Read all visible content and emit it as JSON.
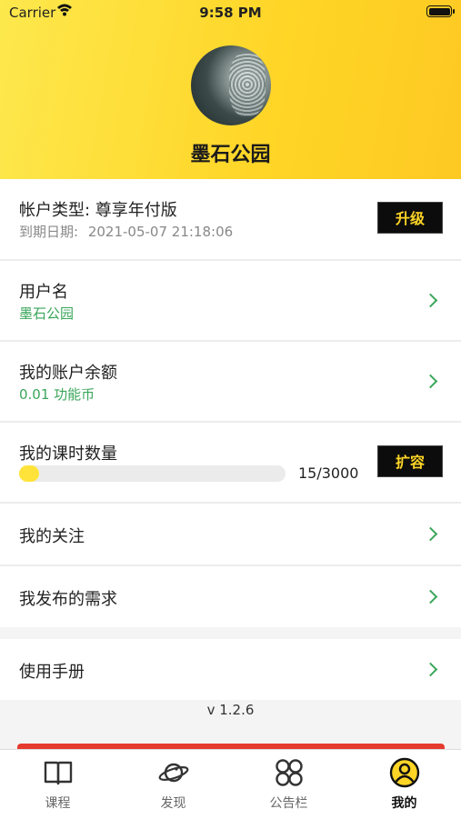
{
  "status_bar": {
    "carrier": "Carrier",
    "time": "9:58 PM"
  },
  "profile": {
    "name": "墨石公园"
  },
  "account": {
    "type_label": "帐户类型: 尊享年付版",
    "expiry_label": "到期日期:",
    "expiry_value": "2021-05-07 21:18:06",
    "upgrade_button": "升级"
  },
  "username": {
    "title": "用户名",
    "value": "墨石公园"
  },
  "balance": {
    "title": "我的账户余额",
    "value": "0.01 功能币"
  },
  "lessons": {
    "title": "我的课时数量",
    "used": 15,
    "total": 3000,
    "progress_text": "15/3000",
    "expand_button": "扩容"
  },
  "menu": {
    "follow": "我的关注",
    "requests": "我发布的需求",
    "manual": "使用手册"
  },
  "version": "v 1.2.6",
  "tabs": [
    {
      "label": "课程",
      "icon": "book-icon"
    },
    {
      "label": "发现",
      "icon": "planet-icon"
    },
    {
      "label": "公告栏",
      "icon": "grid-icon"
    },
    {
      "label": "我的",
      "icon": "user-circle-icon",
      "active": true
    }
  ],
  "colors": {
    "accent": "#ffd526",
    "green": "#3aa65a",
    "red_bar": "#e53b2e"
  }
}
